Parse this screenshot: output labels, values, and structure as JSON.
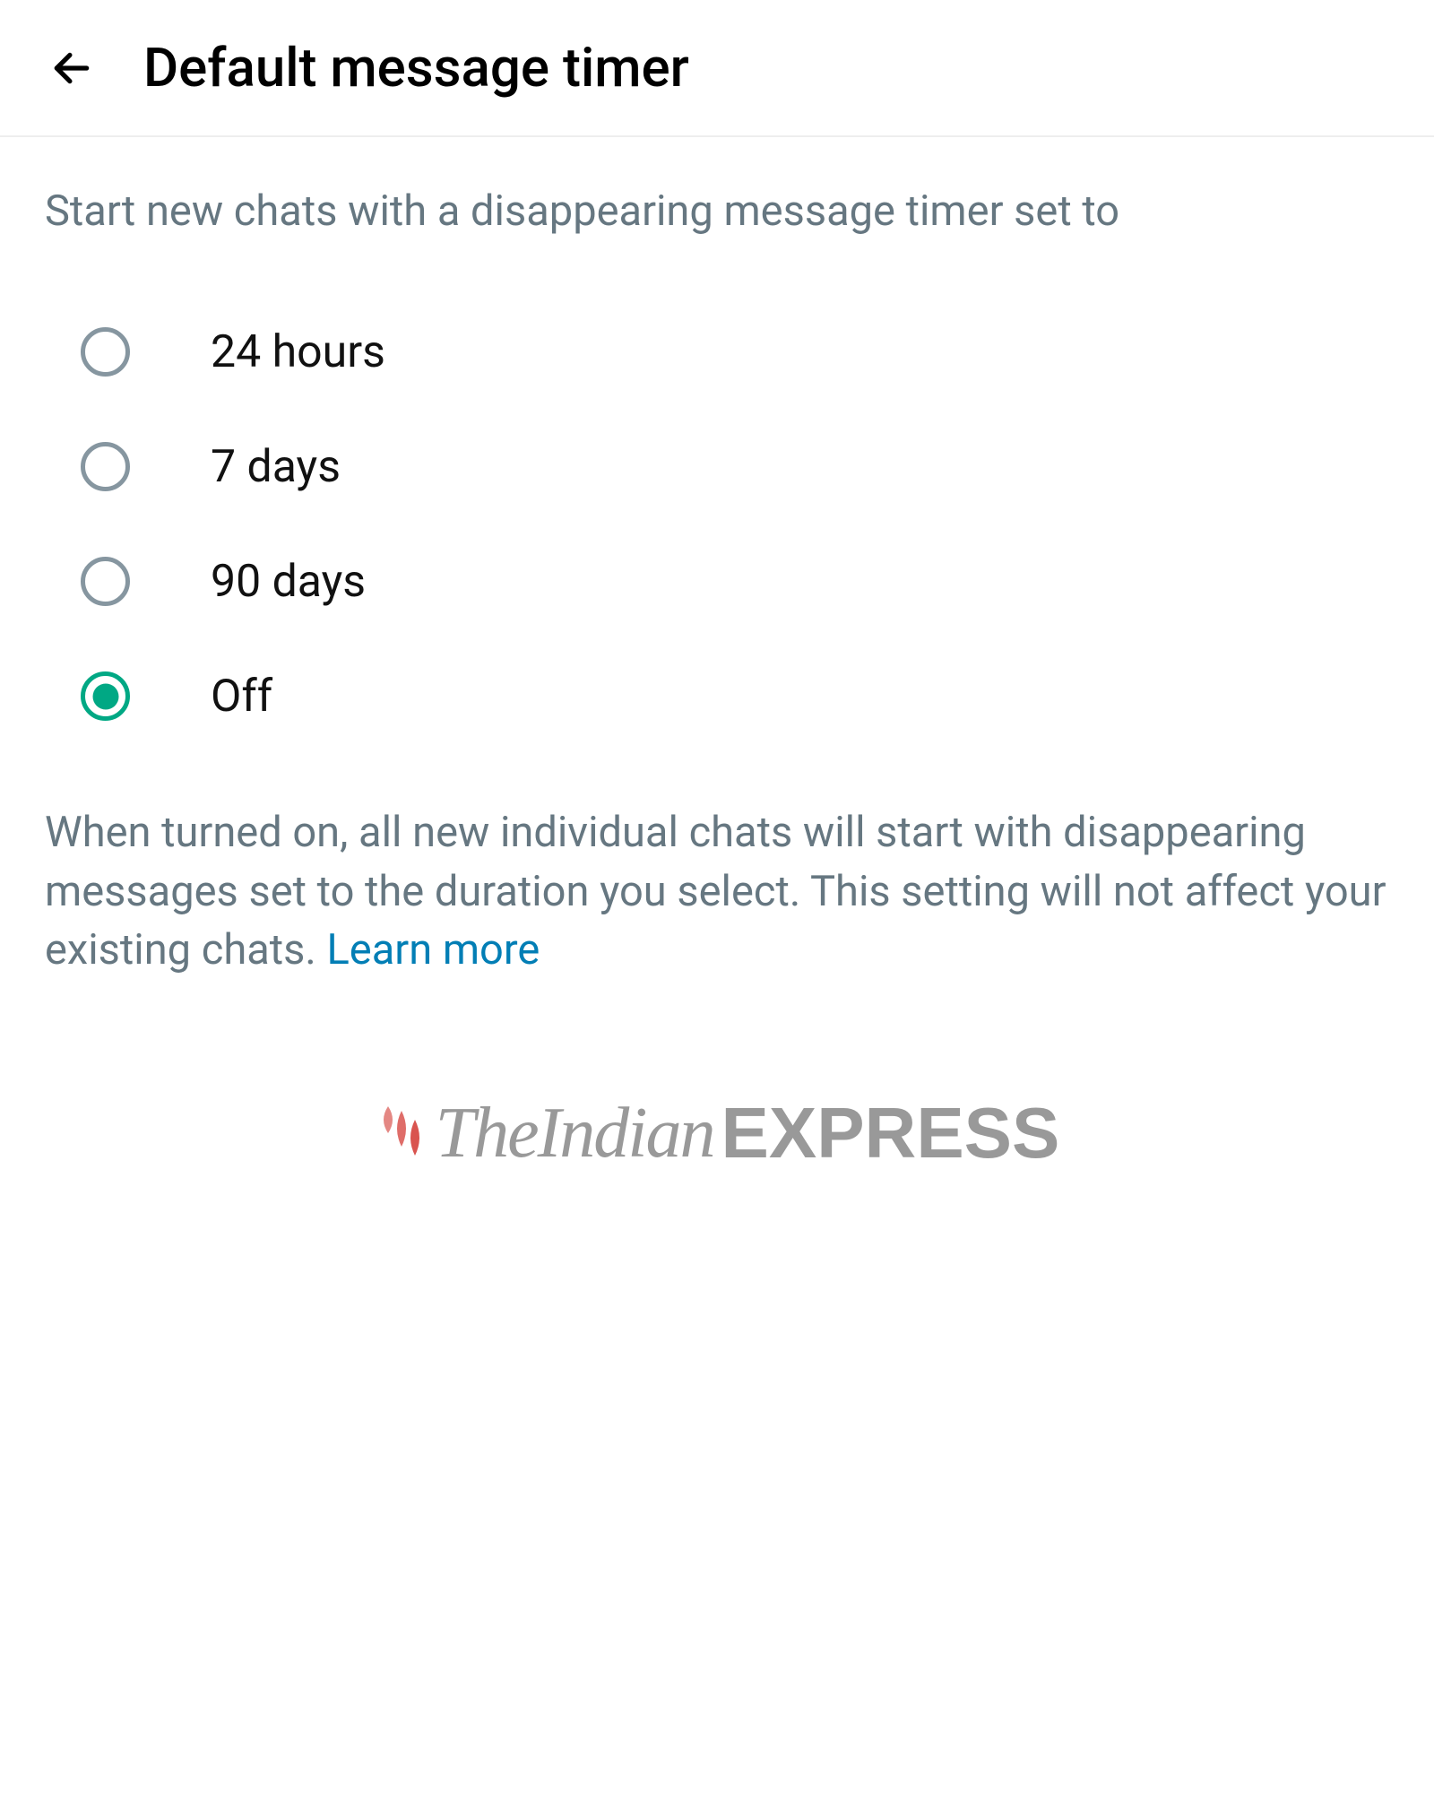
{
  "header": {
    "title": "Default message timer"
  },
  "description": "Start new chats with a disappearing message timer set to",
  "options": [
    {
      "label": "24 hours",
      "selected": false
    },
    {
      "label": "7 days",
      "selected": false
    },
    {
      "label": "90 days",
      "selected": false
    },
    {
      "label": "Off",
      "selected": true
    }
  ],
  "footer": {
    "text": "When turned on, all new individual chats will start with disappearing messages set to the duration you select. This setting will not affect your existing chats. ",
    "learn_more": "Learn more"
  },
  "watermark": {
    "part1": "TheIndian",
    "part2": "EXPRESS"
  }
}
